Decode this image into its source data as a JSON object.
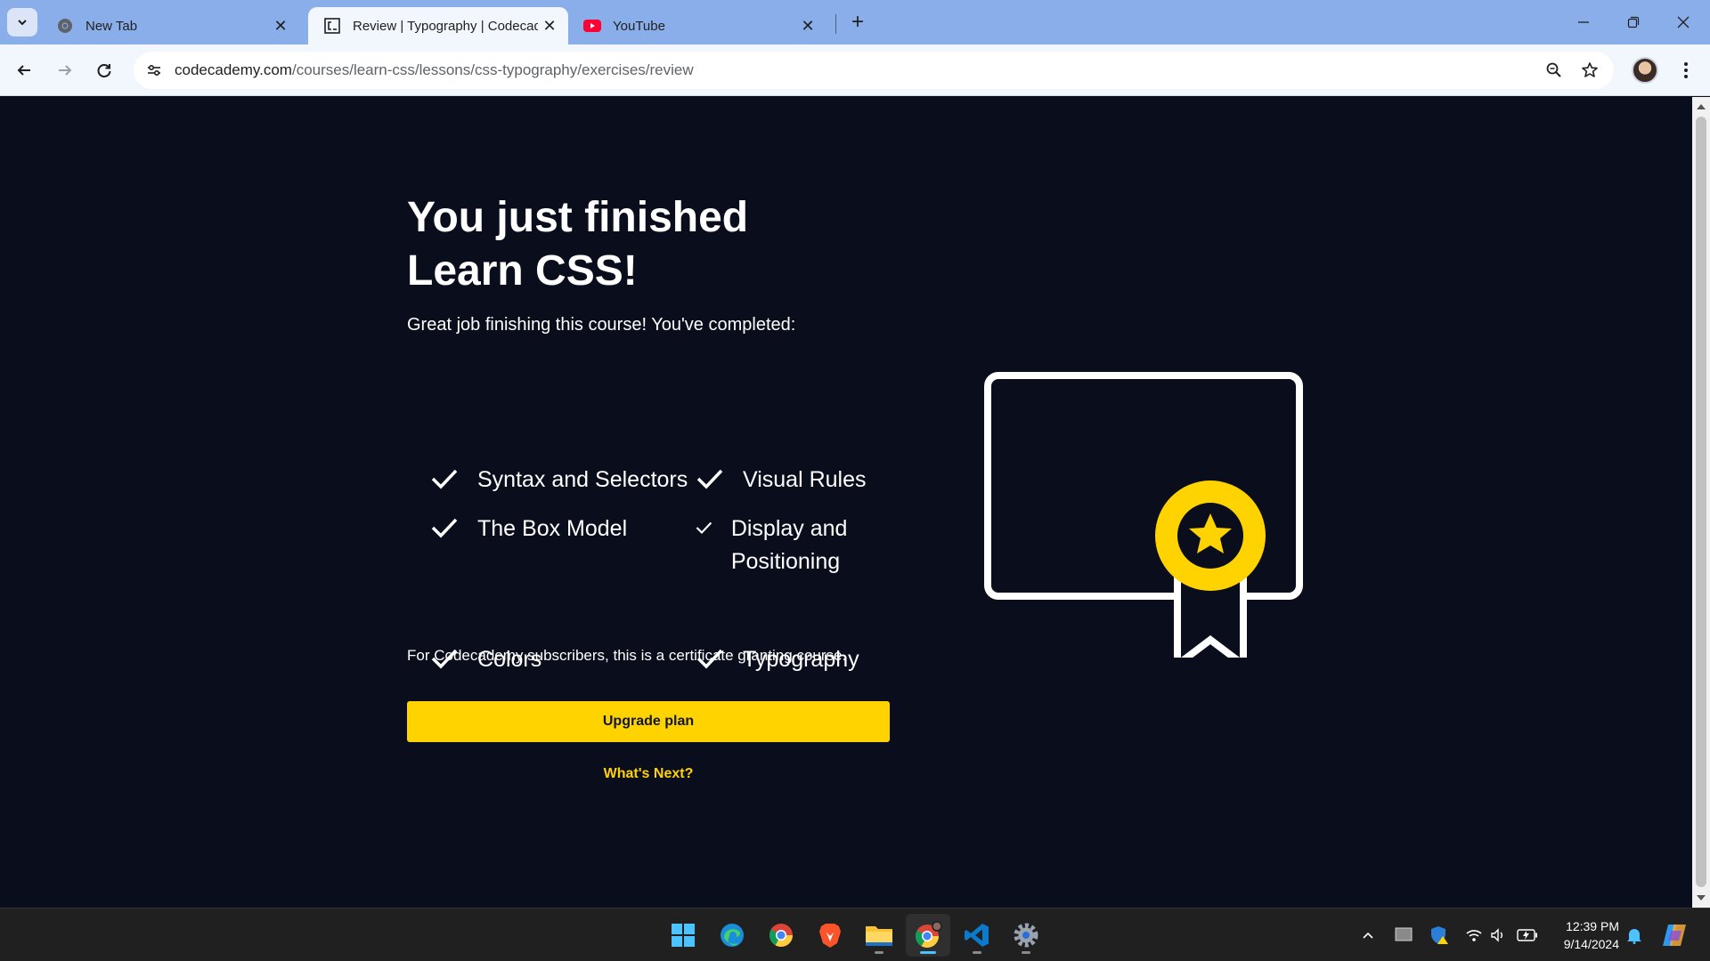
{
  "browser": {
    "tabs": [
      {
        "title": "New Tab",
        "icon": "chrome-icon",
        "active": false
      },
      {
        "title": "Review | Typography | Codecademy",
        "icon": "codecademy-icon",
        "active": true
      },
      {
        "title": "YouTube",
        "icon": "youtube-icon",
        "active": false
      }
    ],
    "tab_close_glyph": "✕",
    "new_tab_glyph": "+",
    "url_domain": "codecademy.com",
    "url_path": "/courses/learn-css/lessons/css-typography/exercises/review"
  },
  "page": {
    "heading": "You just finished Learn CSS!",
    "subtitle": "Great job finishing this course! You've completed:",
    "completed": [
      "Syntax and Selectors",
      "Visual Rules",
      "The Box Model",
      "Display and Positioning",
      "Colors",
      "Typography"
    ],
    "note": "For Codecademy subscribers, this is a certificate granting course.",
    "upgrade_label": "Upgrade plan",
    "whats_next_label": "What's Next?"
  },
  "taskbar": {
    "apps": [
      "start-icon",
      "edge-icon",
      "chrome-icon",
      "brave-icon",
      "file-explorer-icon",
      "chrome-profile-icon",
      "vscode-icon",
      "settings-icon"
    ],
    "time": "12:39 PM",
    "date": "9/14/2024"
  },
  "colors": {
    "page_bg": "#0a0d1c",
    "accent_yellow": "#ffd300",
    "tab_strip": "#8aaee9",
    "toolbar": "#f2f6fd"
  }
}
